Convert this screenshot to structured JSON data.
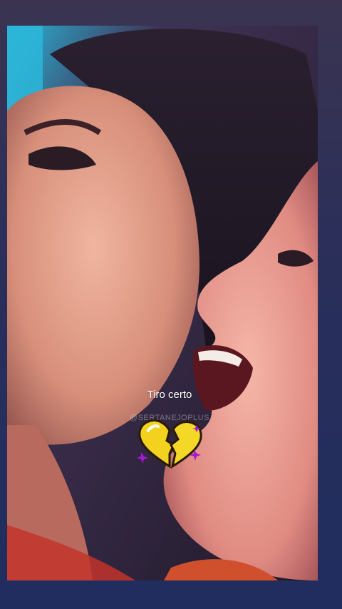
{
  "story": {
    "caption": "Tiro certo",
    "watermark": "@SERTANEJOPLUS",
    "sticker_icon": "yellow-broken-heart-sticker-icon"
  },
  "colors": {
    "background": "#222b55",
    "caption": "#ffffff",
    "heart": "#f2d21f",
    "sparkle": "#a51ad1"
  }
}
